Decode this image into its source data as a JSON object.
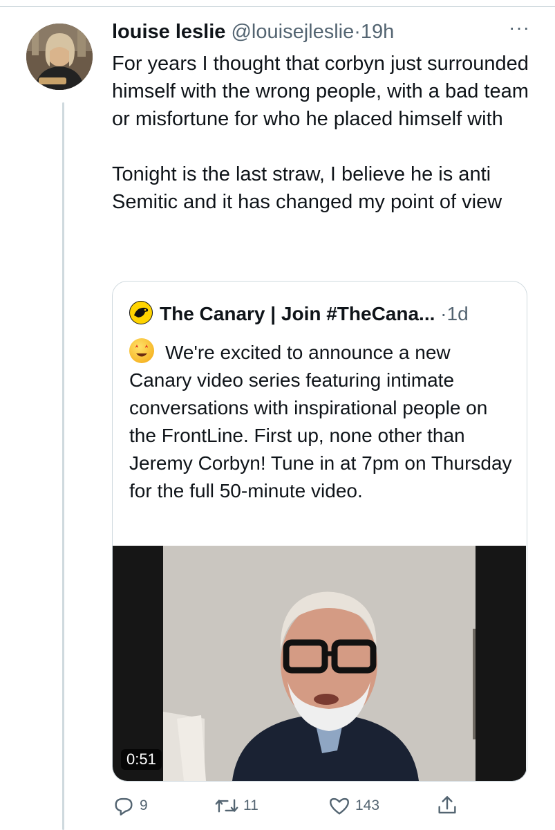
{
  "tweet": {
    "author_name": "louise leslie",
    "author_handle": "@louisejleslie",
    "separator": "·",
    "time": "19h",
    "more_label": "···",
    "text": "For years I thought that corbyn just surrounded himself with the wrong people, with a bad team or misfortune for who he placed himself with\n\nTonight is the last straw, I believe he is anti Semitic and it has changed my point of view"
  },
  "quoted": {
    "author_name": "The Canary | Join #TheCana...",
    "separator": "·",
    "time": "1d",
    "text": "We're excited to announce a new Canary video series featuring intimate conversations with inspirational people on the FrontLine. First up, none other than Jeremy Corbyn! Tune in at 7pm on Thursday for the full 50-minute video.",
    "emoji_icon": "star-struck-emoji",
    "video": {
      "duration": "0:51"
    }
  },
  "actions": {
    "reply_count": "9",
    "retweet_count": "11",
    "like_count": "143"
  },
  "colors": {
    "text": "#0f1419",
    "secondary": "#536471",
    "border": "#cfd9de"
  }
}
